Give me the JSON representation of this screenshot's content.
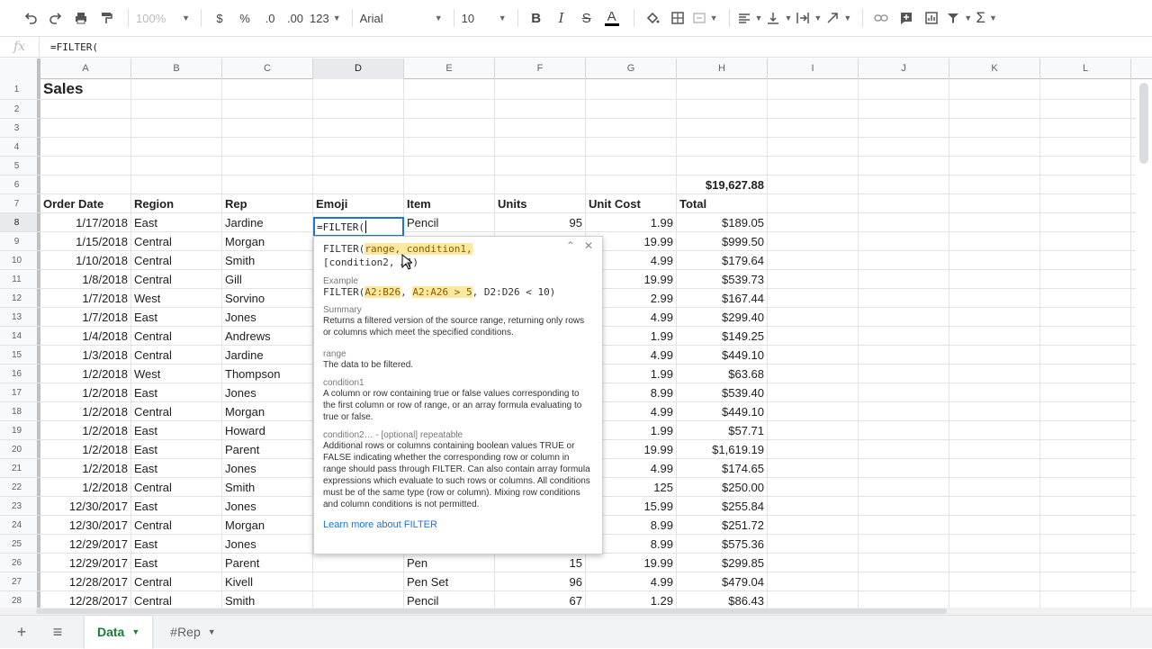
{
  "toolbar": {
    "undo_icon": "undo-icon",
    "redo_icon": "redo-icon",
    "zoom": "100%",
    "currency": "$",
    "percent": "%",
    "dec_decrease": ".0",
    "dec_increase": ".00",
    "more_formats": "123",
    "font": "Arial",
    "font_size": "10"
  },
  "formula_bar": {
    "fx": "fx",
    "content": "=FILTER("
  },
  "columns": [
    "A",
    "B",
    "C",
    "D",
    "E",
    "F",
    "G",
    "H",
    "I",
    "J",
    "K",
    "L"
  ],
  "rows": [
    {
      "n": "1",
      "A": "Sales"
    },
    {
      "n": "2"
    },
    {
      "n": "3"
    },
    {
      "n": "4"
    },
    {
      "n": "5"
    },
    {
      "n": "6",
      "H": "$19,627.88"
    },
    {
      "n": "7",
      "A": "Order Date",
      "B": "Region",
      "C": "Rep",
      "D": "Emoji",
      "E": "Item",
      "F": "Units",
      "G": "Unit Cost",
      "H": "Total"
    },
    {
      "n": "8",
      "A": "1/17/2018",
      "B": "East",
      "C": "Jardine",
      "E": "Pencil",
      "F": "95",
      "G": "1.99",
      "H": "$189.05"
    },
    {
      "n": "9",
      "A": "1/15/2018",
      "B": "Central",
      "C": "Morgan",
      "G": "19.99",
      "H": "$999.50"
    },
    {
      "n": "10",
      "A": "1/10/2018",
      "B": "Central",
      "C": "Smith",
      "G": "4.99",
      "H": "$179.64"
    },
    {
      "n": "11",
      "A": "1/8/2018",
      "B": "Central",
      "C": "Gill",
      "G": "19.99",
      "H": "$539.73"
    },
    {
      "n": "12",
      "A": "1/7/2018",
      "B": "West",
      "C": "Sorvino",
      "G": "2.99",
      "H": "$167.44"
    },
    {
      "n": "13",
      "A": "1/7/2018",
      "B": "East",
      "C": "Jones",
      "G": "4.99",
      "H": "$299.40"
    },
    {
      "n": "14",
      "A": "1/4/2018",
      "B": "Central",
      "C": "Andrews",
      "G": "1.99",
      "H": "$149.25"
    },
    {
      "n": "15",
      "A": "1/3/2018",
      "B": "Central",
      "C": "Jardine",
      "G": "4.99",
      "H": "$449.10"
    },
    {
      "n": "16",
      "A": "1/2/2018",
      "B": "West",
      "C": "Thompson",
      "G": "1.99",
      "H": "$63.68"
    },
    {
      "n": "17",
      "A": "1/2/2018",
      "B": "East",
      "C": "Jones",
      "G": "8.99",
      "H": "$539.40"
    },
    {
      "n": "18",
      "A": "1/2/2018",
      "B": "Central",
      "C": "Morgan",
      "G": "4.99",
      "H": "$449.10"
    },
    {
      "n": "19",
      "A": "1/2/2018",
      "B": "East",
      "C": "Howard",
      "G": "1.99",
      "H": "$57.71"
    },
    {
      "n": "20",
      "A": "1/2/2018",
      "B": "East",
      "C": "Parent",
      "G": "19.99",
      "H": "$1,619.19"
    },
    {
      "n": "21",
      "A": "1/2/2018",
      "B": "East",
      "C": "Jones",
      "G": "4.99",
      "H": "$174.65"
    },
    {
      "n": "22",
      "A": "1/2/2018",
      "B": "Central",
      "C": "Smith",
      "G": "125",
      "H": "$250.00"
    },
    {
      "n": "23",
      "A": "12/30/2017",
      "B": "East",
      "C": "Jones",
      "G": "15.99",
      "H": "$255.84"
    },
    {
      "n": "24",
      "A": "12/30/2017",
      "B": "Central",
      "C": "Morgan",
      "G": "8.99",
      "H": "$251.72"
    },
    {
      "n": "25",
      "A": "12/29/2017",
      "B": "East",
      "C": "Jones",
      "G": "8.99",
      "H": "$575.36"
    },
    {
      "n": "26",
      "A": "12/29/2017",
      "B": "East",
      "C": "Parent",
      "E": "Pen",
      "F": "15",
      "G": "19.99",
      "H": "$299.85"
    },
    {
      "n": "27",
      "A": "12/28/2017",
      "B": "Central",
      "C": "Kivell",
      "E": "Pen Set",
      "F": "96",
      "G": "4.99",
      "H": "$479.04"
    },
    {
      "n": "28",
      "A": "12/28/2017",
      "B": "Central",
      "C": "Smith",
      "E": "Pencil",
      "F": "67",
      "G": "1.29",
      "H": "$86.43"
    }
  ],
  "active_cell": {
    "value": "=FILTER("
  },
  "help": {
    "signature_a": "FILTER(",
    "signature_b": "range, condition1,",
    "signature_c": "[condition2, …])",
    "example_head": "Example",
    "example_a": "FILTER(",
    "example_b": "A2:B26",
    "example_c": ", ",
    "example_d": "A2:A26 > 5",
    "example_e": ", D2:D26 < 10)",
    "summary_head": "Summary",
    "summary": "Returns a filtered version of the source range, returning only rows or columns which meet the specified conditions.",
    "range_head": "range",
    "range_text": "The data to be filtered.",
    "cond1_head": "condition1",
    "cond1_text": "A column or row containing true or false values corresponding to the first column or row of range, or an array formula evaluating to true or false.",
    "cond2_head": "condition2… - [optional] repeatable",
    "cond2_text": "Additional rows or columns containing boolean values TRUE or FALSE indicating whether the corresponding row or column in range should pass through FILTER. Can also contain array formula expressions which evaluate to such rows or columns. All conditions must be of the same type (row or column). Mixing row conditions and column conditions is not permitted.",
    "link": "Learn more about FILTER"
  },
  "sheets": [
    {
      "label": "Data",
      "active": true
    },
    {
      "label": "#Rep",
      "active": false
    }
  ],
  "colors": {
    "accent": "#1a73e8",
    "tab_active": "#188038"
  }
}
